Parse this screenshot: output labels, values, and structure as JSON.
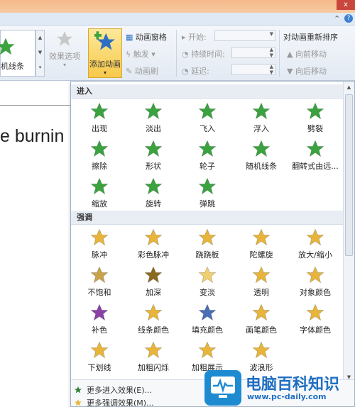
{
  "window": {
    "close_glyph": "x"
  },
  "ribbon_tabs": {
    "help_glyph": "?"
  },
  "ribbon": {
    "gallery_label": "机线条",
    "effect_options": "效果选项",
    "add_animation": "添加动画",
    "animation_pane": "动画窗格",
    "trigger": "触发",
    "animation_painter": "动画刷",
    "start_label": "开始:",
    "duration_label": "持续时间:",
    "delay_label": "延迟:",
    "reorder_title": "对动画重新排序",
    "move_earlier": "向前移动",
    "move_later": "向后移动"
  },
  "slide": {
    "text": "e burnin"
  },
  "dropdown": {
    "sections": [
      {
        "title": "进入",
        "items": [
          {
            "label": "出现",
            "color": "#3aa33f"
          },
          {
            "label": "淡出",
            "color": "#3aa33f"
          },
          {
            "label": "飞入",
            "color": "#3aa33f"
          },
          {
            "label": "浮入",
            "color": "#3aa33f"
          },
          {
            "label": "劈裂",
            "color": "#3aa33f"
          },
          {
            "label": "擦除",
            "color": "#3aa33f"
          },
          {
            "label": "形状",
            "color": "#3aa33f"
          },
          {
            "label": "轮子",
            "color": "#3aa33f"
          },
          {
            "label": "随机线条",
            "color": "#3aa33f"
          },
          {
            "label": "翻转式由远...",
            "color": "#3aa33f"
          },
          {
            "label": "缩放",
            "color": "#3aa33f"
          },
          {
            "label": "旋转",
            "color": "#3aa33f"
          },
          {
            "label": "弹跳",
            "color": "#3aa33f"
          }
        ]
      },
      {
        "title": "强调",
        "items": [
          {
            "label": "脉冲",
            "color": "#e8b53a"
          },
          {
            "label": "彩色脉冲",
            "color": "#e8b53a"
          },
          {
            "label": "跷跷板",
            "color": "#e8b53a"
          },
          {
            "label": "陀螺旋",
            "color": "#e8b53a"
          },
          {
            "label": "放大/缩小",
            "color": "#e8b53a"
          },
          {
            "label": "不饱和",
            "color": "#c9a24a"
          },
          {
            "label": "加深",
            "color": "#8a6a20"
          },
          {
            "label": "变淡",
            "color": "#f2cf6e"
          },
          {
            "label": "透明",
            "color": "#e8b53a"
          },
          {
            "label": "对象颜色",
            "color": "#e8b53a"
          },
          {
            "label": "补色",
            "color": "#8b3fa8"
          },
          {
            "label": "线条颜色",
            "color": "#e8b53a"
          },
          {
            "label": "填充颜色",
            "color": "#4a6fb5"
          },
          {
            "label": "画笔颜色",
            "color": "#e8b53a"
          },
          {
            "label": "字体颜色",
            "color": "#e8b53a"
          },
          {
            "label": "下划线",
            "color": "#e8b53a"
          },
          {
            "label": "加粗闪烁",
            "color": "#e8b53a"
          },
          {
            "label": "加粗展示",
            "color": "#e8b53a"
          },
          {
            "label": "波浪形",
            "color": "#e8b53a"
          }
        ]
      }
    ],
    "footer": {
      "more_entrance": "更多进入效果(E)...",
      "more_emphasis": "更多强调效果(M)..."
    }
  },
  "watermark": {
    "name": "电脑百科知识",
    "url": "www.pc-daily.com"
  }
}
